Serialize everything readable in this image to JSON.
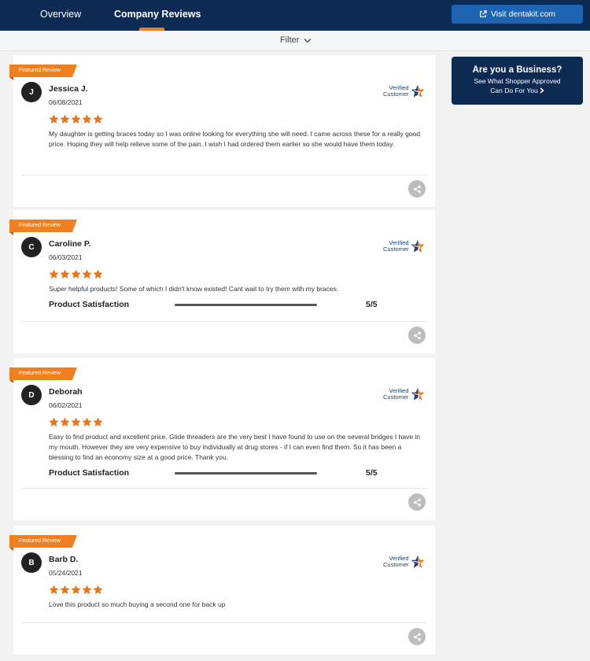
{
  "header": {
    "tabs": [
      {
        "label": "Overview",
        "active": false
      },
      {
        "label": "Company Reviews",
        "active": true
      }
    ],
    "visit_button": {
      "label": "Visit dentakit.com",
      "icon": "external-link-icon"
    },
    "accent_color": "#f0801f",
    "nav_color": "#0c2a52"
  },
  "filter": {
    "label": "Filter",
    "icon": "chevron-down-icon"
  },
  "promo": {
    "title": "Are you a Business?",
    "line1": "See What Shopper Approved",
    "line2": "Can Do For You"
  },
  "reviews": [
    {
      "badge": "Featured Review",
      "initial": "J",
      "name": "Jessica J.",
      "date": "06/08/2021",
      "verified_line1": "Verified",
      "verified_line2": "Customer",
      "rating": 5,
      "text": "My daughter is getting braces today so I was online looking for everything she will need. I came across these for a really good price. Hoping they will help relieve some of the pain. I wish I had ordered them earlier so she would have them today.",
      "product_satisfaction": null
    },
    {
      "badge": "Featured Review",
      "initial": "C",
      "name": "Caroline P.",
      "date": "06/03/2021",
      "verified_line1": "Verified",
      "verified_line2": "Customer",
      "rating": 5,
      "text": "Super helpful products! Some of which I didn't know existed! Cant wait to try them with my braces.",
      "product_satisfaction": {
        "label": "Product Satisfaction",
        "value": "5/5",
        "fraction": 1.0
      }
    },
    {
      "badge": "Featured Review",
      "initial": "D",
      "name": "Deborah",
      "date": "06/02/2021",
      "verified_line1": "Verified",
      "verified_line2": "Customer",
      "rating": 5,
      "text": "Easy to find product and excellent price. Glide threaders are the very best I have found to use on the several bridges I have in my mouth. However they are very expensive to buy individually at drug stores - if I can even find them. So it has been a blessing to find an economy size at a good price. Thank you.",
      "product_satisfaction": {
        "label": "Product Satisfaction",
        "value": "5/5",
        "fraction": 1.0
      }
    },
    {
      "badge": "Featured Review",
      "initial": "B",
      "name": "Barb D.",
      "date": "05/24/2021",
      "verified_line1": "Verified",
      "verified_line2": "Customer",
      "rating": 5,
      "text": "Love this product so much buying a second one for back up",
      "product_satisfaction": null
    }
  ]
}
